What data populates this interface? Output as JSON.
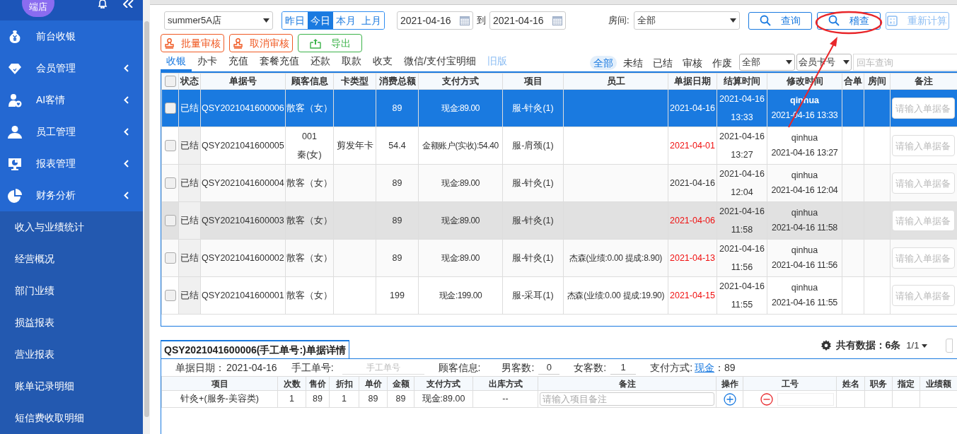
{
  "sidebar": {
    "avatar": "端店",
    "menu": [
      {
        "label": "前台收银",
        "kind": "cashier",
        "caret": false
      },
      {
        "label": "会员管理",
        "kind": "members",
        "caret": true
      },
      {
        "label": "AI客情",
        "kind": "ai",
        "caret": true
      },
      {
        "label": "员工管理",
        "kind": "staff",
        "caret": true
      },
      {
        "label": "报表管理",
        "kind": "reports",
        "caret": true
      },
      {
        "label": "财务分析",
        "kind": "finance",
        "caret": true
      }
    ],
    "submenu": [
      "收入与业绩统计",
      "经营概况",
      "部门业绩",
      "损益报表",
      "营业报表",
      "账单记录明细",
      "短信费收取明细"
    ]
  },
  "toolbar": {
    "store": "summer5A店",
    "periods": [
      {
        "label": "昨日",
        "selected": false
      },
      {
        "label": "今日",
        "selected": true
      },
      {
        "label": "本月",
        "selected": false
      },
      {
        "label": "上月",
        "selected": false
      }
    ],
    "date_from": "2021-04-16",
    "to_label": "到",
    "date_to": "2021-04-16",
    "room_label": "房间:",
    "room": "全部",
    "buttons": [
      {
        "label": "查询",
        "kind": "search",
        "disabled": false
      },
      {
        "label": "稽查",
        "kind": "search",
        "disabled": false
      },
      {
        "label": "重新计算",
        "kind": "calc",
        "disabled": true
      }
    ],
    "actions": [
      {
        "label": "批量审核",
        "kind": "audit"
      },
      {
        "label": "取消审核",
        "kind": "audit"
      },
      {
        "label": "导出",
        "kind": "export"
      }
    ]
  },
  "tabs": [
    {
      "label": "收银",
      "selected": true,
      "kind": "tab"
    },
    {
      "label": "办卡",
      "selected": false,
      "kind": "tab"
    },
    {
      "label": "充值",
      "selected": false,
      "kind": "tab"
    },
    {
      "label": "套餐充值",
      "selected": false,
      "kind": "tab"
    },
    {
      "label": "还款",
      "selected": false,
      "kind": "tab"
    },
    {
      "label": "取款",
      "selected": false,
      "kind": "tab"
    },
    {
      "label": "收支",
      "selected": false,
      "kind": "tab"
    },
    {
      "label": "微信/支付宝明细",
      "selected": false,
      "kind": "tab"
    },
    {
      "label": "旧版",
      "selected": false,
      "kind": "legacy"
    }
  ],
  "filters": [
    {
      "label": "全部",
      "selected": true
    },
    {
      "label": "未结",
      "selected": false
    },
    {
      "label": "已结",
      "selected": false
    },
    {
      "label": "审核",
      "selected": false
    },
    {
      "label": "作废",
      "selected": false
    }
  ],
  "filter_select": "全部",
  "card_select": "会员卡号",
  "search_placeholder": "回车查询",
  "table": {
    "header_checked": false,
    "columns": [
      "状态",
      "单据号",
      "顾客信息",
      "卡类型",
      "消费总额",
      "支付方式",
      "项目",
      "员工",
      "单据日期",
      "结算时间",
      "修改时间",
      "合单",
      "房间",
      "备注"
    ],
    "rows": [
      {
        "checked": false,
        "selected": true,
        "hovered": false,
        "status": "已结",
        "number": "QSY2021041600006",
        "customer": "散客（女）",
        "total": "89",
        "payment": "现金:89.00",
        "item": "服-针灸(1)",
        "date": "2021-04-16",
        "date_flagged": false,
        "settled_at": "2021-04-16 13:33",
        "modifier": "qinhua",
        "modified_at": "2021-04-16 13:33",
        "remark_placeholder": "请输入单据备"
      },
      {
        "checked": false,
        "selected": false,
        "hovered": false,
        "status": "已结",
        "number": "QSY2021041600005",
        "customer": "001\n秦(女)",
        "card_type": "剪发年卡",
        "total": "54.4",
        "payment": "金额账户(实收):54.40",
        "item": "服-肩颈(1)",
        "date": "2021-04-01",
        "date_flagged": true,
        "settled_at": "2021-04-16 13:27",
        "modifier": "qinhua",
        "modified_at": "2021-04-16 13:27",
        "remark_placeholder": "请输入单据备"
      },
      {
        "checked": false,
        "selected": false,
        "hovered": false,
        "status": "已结",
        "number": "QSY2021041600004",
        "customer": "散客（女）",
        "total": "89",
        "payment": "现金:89.00",
        "item": "服-针灸(1)",
        "date": "2021-04-16",
        "date_flagged": false,
        "settled_at": "2021-04-16 12:04",
        "modifier": "qinhua",
        "modified_at": "2021-04-16 12:04",
        "remark_placeholder": "请输入单据备"
      },
      {
        "checked": false,
        "selected": false,
        "hovered": true,
        "status": "已结",
        "number": "QSY2021041600003",
        "customer": "散客（女）",
        "total": "89",
        "payment": "现金:89.00",
        "item": "服-针灸(1)",
        "date": "2021-04-06",
        "date_flagged": true,
        "settled_at": "2021-04-16 11:58",
        "modifier": "qinhua",
        "modified_at": "2021-04-16 11:58",
        "remark_placeholder": "请输入单据备"
      },
      {
        "checked": false,
        "selected": false,
        "hovered": false,
        "status": "已结",
        "number": "QSY2021041600002",
        "customer": "散客（女）",
        "total": "89",
        "payment": "现金:89.00",
        "item": "服-针灸(1)",
        "staff": "杰森(业绩:0.00 提成:8.90)",
        "date": "2021-04-13",
        "date_flagged": true,
        "settled_at": "2021-04-16 11:56",
        "modifier": "qinhua",
        "modified_at": "2021-04-16 11:56",
        "remark_placeholder": "请输入单据备"
      },
      {
        "checked": false,
        "selected": false,
        "hovered": false,
        "status": "已结",
        "number": "QSY2021041600001",
        "customer": "散客（女）",
        "total": "199",
        "payment": "现金:199.00",
        "item": "服-采耳(1)",
        "staff": "杰森(业绩:0.00 提成:19.90)",
        "date": "2021-04-15",
        "date_flagged": true,
        "settled_at": "2021-04-16 11:55",
        "modifier": "qinhua",
        "modified_at": "2021-04-16 11:55",
        "remark_placeholder": "请输入单据备"
      }
    ]
  },
  "detail": {
    "title": "QSY2021041600006(手工单号:)单据详情",
    "total_label": "共有数据：",
    "total_count": "6条",
    "page": "1/1",
    "date_label": "单据日期：",
    "date": "2021-04-16",
    "manual_label": "手工单号:",
    "manual_placeholder": "手工单号",
    "customer_label": "顾客信息:",
    "male_label": "男客数:",
    "male": "0",
    "female_label": "女客数:",
    "female": "1",
    "payment_label": "支付方式:",
    "payment_link": "现金",
    "payment_amount": "：89",
    "columns": [
      "项目",
      "次数",
      "售价",
      "折扣",
      "单价",
      "金额",
      "支付方式",
      "出库方式",
      "备注",
      "操作",
      "工号",
      "姓名",
      "职务",
      "指定",
      "业绩额"
    ],
    "rows": [
      {
        "item": "针灸+(服务-美容类)",
        "count": "1",
        "price": "89",
        "discount": "1",
        "unit_price": "89",
        "amount": "89",
        "payment": "现金:89.00",
        "stock": "--",
        "remark_placeholder": "请输入项目备注"
      }
    ]
  }
}
